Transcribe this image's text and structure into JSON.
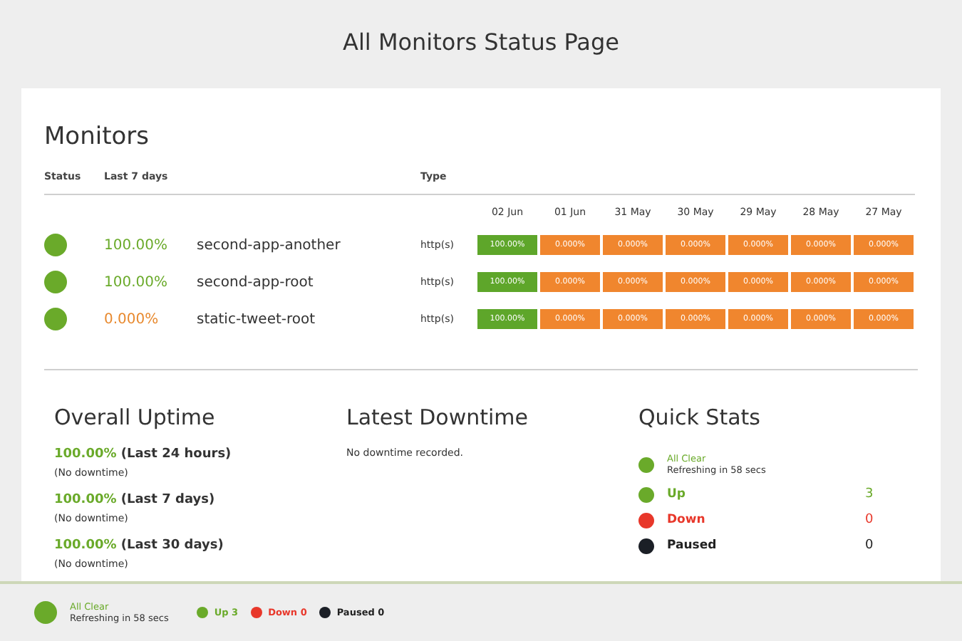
{
  "page_title": "All Monitors Status Page",
  "monitors": {
    "title": "Monitors",
    "columns": {
      "status": "Status",
      "last_7_days": "Last 7 days",
      "type": "Type"
    },
    "days": [
      "02 Jun",
      "01 Jun",
      "31 May",
      "30 May",
      "29 May",
      "28 May",
      "27 May"
    ],
    "rows": [
      {
        "color": "#6aaa2a",
        "uptime": "100.00%",
        "kind": "good",
        "name": "second-app-another",
        "type": "http(s)",
        "days": [
          {
            "value": "100.00%",
            "kind": "up"
          },
          {
            "value": "0.000%",
            "kind": "down"
          },
          {
            "value": "0.000%",
            "kind": "down"
          },
          {
            "value": "0.000%",
            "kind": "down"
          },
          {
            "value": "0.000%",
            "kind": "down"
          },
          {
            "value": "0.000%",
            "kind": "down"
          },
          {
            "value": "0.000%",
            "kind": "down"
          }
        ]
      },
      {
        "color": "#6aaa2a",
        "uptime": "100.00%",
        "kind": "good",
        "name": "second-app-root",
        "type": "http(s)",
        "days": [
          {
            "value": "100.00%",
            "kind": "up"
          },
          {
            "value": "0.000%",
            "kind": "down"
          },
          {
            "value": "0.000%",
            "kind": "down"
          },
          {
            "value": "0.000%",
            "kind": "down"
          },
          {
            "value": "0.000%",
            "kind": "down"
          },
          {
            "value": "0.000%",
            "kind": "down"
          },
          {
            "value": "0.000%",
            "kind": "down"
          }
        ]
      },
      {
        "color": "#6aaa2a",
        "uptime": "0.000%",
        "kind": "bad",
        "name": "static-tweet-root",
        "type": "http(s)",
        "days": [
          {
            "value": "100.00%",
            "kind": "up"
          },
          {
            "value": "0.000%",
            "kind": "down"
          },
          {
            "value": "0.000%",
            "kind": "down"
          },
          {
            "value": "0.000%",
            "kind": "down"
          },
          {
            "value": "0.000%",
            "kind": "down"
          },
          {
            "value": "0.000%",
            "kind": "down"
          },
          {
            "value": "0.000%",
            "kind": "down"
          }
        ]
      }
    ]
  },
  "overall_uptime": {
    "title": "Overall Uptime",
    "items": [
      {
        "value": "100.00%",
        "period": "(Last 24 hours)",
        "note": "(No downtime)"
      },
      {
        "value": "100.00%",
        "period": "(Last 7 days)",
        "note": "(No downtime)"
      },
      {
        "value": "100.00%",
        "period": "(Last 30 days)",
        "note": "(No downtime)"
      }
    ]
  },
  "latest_downtime": {
    "title": "Latest Downtime",
    "text": "No downtime recorded."
  },
  "quick_stats": {
    "title": "Quick Stats",
    "summary": {
      "color": "#6aaa2a",
      "label": "All Clear",
      "sub": "Refreshing in 58 secs"
    },
    "items": [
      {
        "label": "Up",
        "count": "3",
        "color": "#6aaa2a"
      },
      {
        "label": "Down",
        "count": "0",
        "color": "#e8372a"
      },
      {
        "label": "Paused",
        "count": "0",
        "color": "#1b1f26"
      }
    ]
  },
  "footer": {
    "summary": {
      "color": "#6aaa2a",
      "label": "All Clear",
      "sub": "Refreshing in 58 secs"
    },
    "items": [
      {
        "label": "Up 3",
        "color": "#6aaa2a"
      },
      {
        "label": "Down 0",
        "color": "#e8372a"
      },
      {
        "label": "Paused 0",
        "color": "#1b1f26"
      }
    ]
  }
}
